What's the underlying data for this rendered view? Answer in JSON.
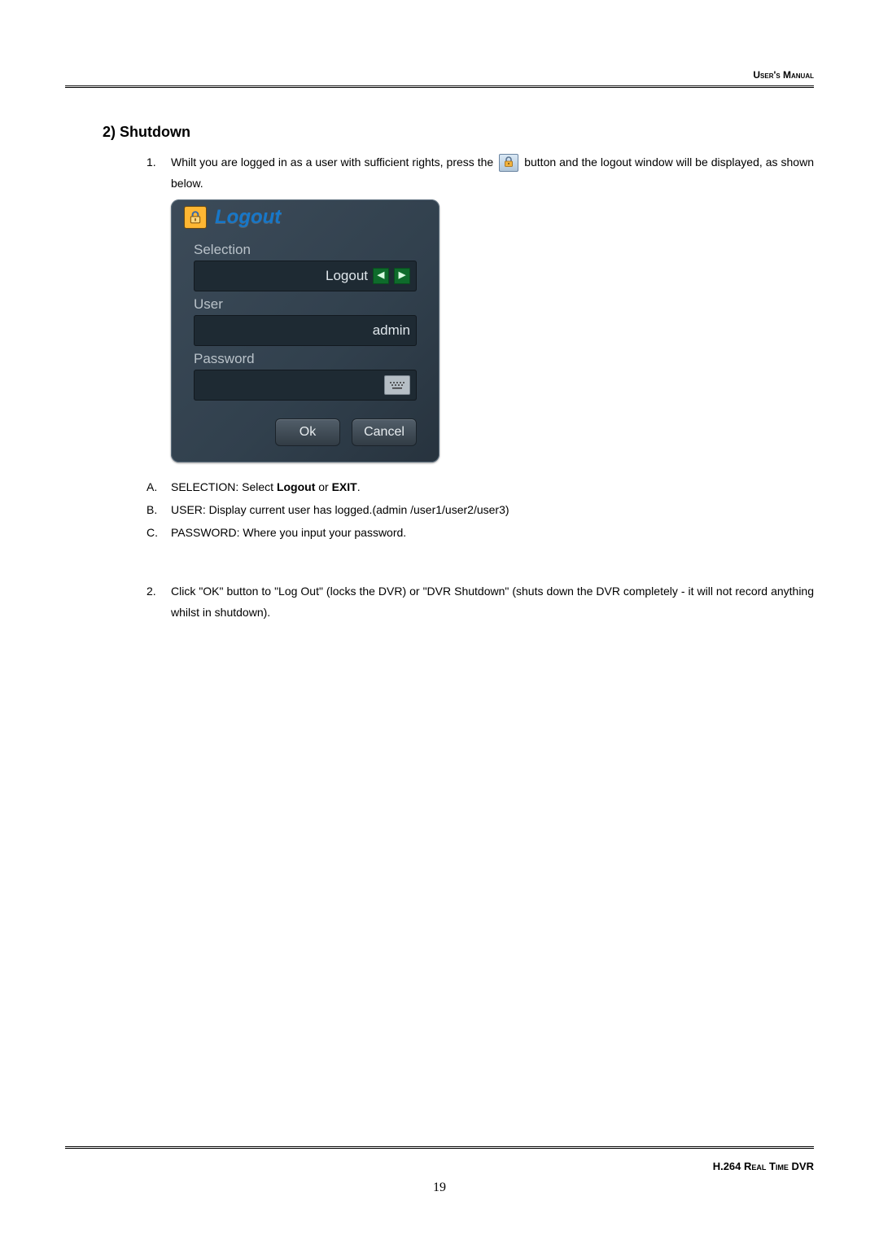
{
  "header": {
    "label": "User's Manual"
  },
  "section": {
    "number": "2)",
    "title": "Shutdown"
  },
  "list1": {
    "item1": {
      "marker": "1.",
      "text_a": "Whilt you are logged in as a user with sufficient rights, press the ",
      "text_b": " button and the logout window will be displayed, as shown below."
    },
    "item2": {
      "marker": "2.",
      "text": "Click \"OK\" button to \"Log Out\" (locks the DVR) or \"DVR Shutdown\" (shuts down the DVR completely - it will not record anything whilst in shutdown)."
    }
  },
  "dialog": {
    "title": "Logout",
    "selection_label": "Selection",
    "selection_value": "Logout",
    "user_label": "User",
    "user_value": "admin",
    "password_label": "Password",
    "ok": "Ok",
    "cancel": "Cancel"
  },
  "alpha": {
    "a": {
      "marker": "A.",
      "prefix": "SELECTION:   Select ",
      "bold1": "Logout",
      "mid": " or ",
      "bold2": "EXIT",
      "suffix": "."
    },
    "b": {
      "marker": "B.",
      "text": "USER: Display current user has logged.(admin /user1/user2/user3)"
    },
    "c": {
      "marker": "C.",
      "text": "PASSWORD: Where you input your password."
    }
  },
  "footer": {
    "label": "H.264 Real Time DVR",
    "page": "19"
  }
}
